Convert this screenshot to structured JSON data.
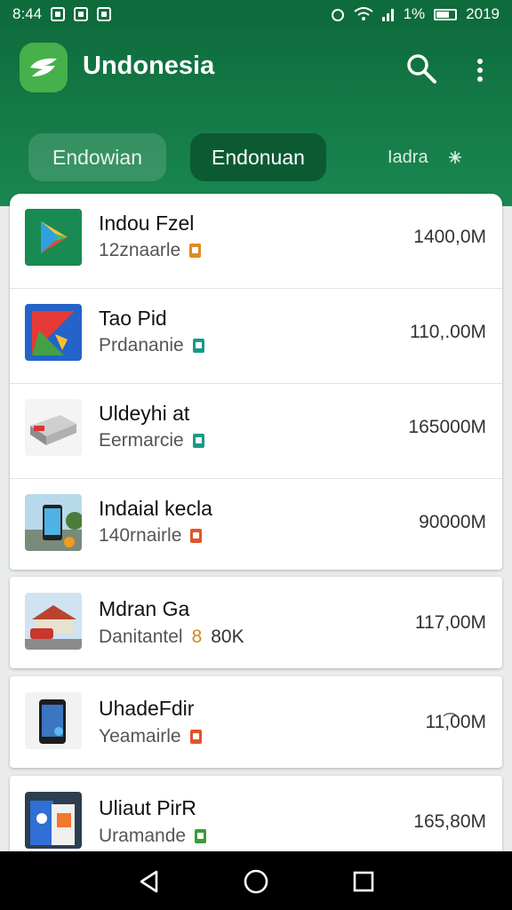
{
  "status": {
    "time": "8:44",
    "battery_text": "1%",
    "year": "2019"
  },
  "header": {
    "title": "Undonesia"
  },
  "tabs": [
    {
      "label": "Endowian"
    },
    {
      "label": "Endonuan"
    },
    {
      "label": "Iadra",
      "icon": "sparkle-icon"
    }
  ],
  "apps": [
    {
      "title": "Indou Fzel",
      "subtitle": "12znaarle",
      "size": "1400,0M",
      "badge_color": "#e08a22",
      "thumb": "play-store"
    },
    {
      "title": "Tao Pid",
      "subtitle": "Prdananie",
      "size": "110,.00M",
      "badge_color": "#189a86",
      "thumb": "colored-shapes"
    },
    {
      "title": "Uldeyhi at",
      "subtitle": "Eermarcie",
      "size": "165000M",
      "badge_color": "#189a86",
      "thumb": "device-box"
    },
    {
      "title": "Indaial kecla",
      "subtitle": "140rnairle",
      "size": "90000M",
      "badge_color": "#e0552a",
      "thumb": "phone-scene"
    },
    {
      "title": "Mdran Ga",
      "subtitle": "Danitantel",
      "subtitle_extra": "8",
      "subtitle_extra2": "80K",
      "size": "117,00M",
      "badge_color": "",
      "thumb": "house-scene"
    },
    {
      "title": "UhadeFdir",
      "subtitle": "Yeamairle",
      "size": "11͡,00M",
      "badge_color": "#e0552a",
      "thumb": "phone-dark"
    },
    {
      "title": "Uliaut PirR",
      "subtitle": "Uramande",
      "size": "165,80M",
      "badge_color": "#3d9a3a",
      "thumb": "brochure"
    }
  ],
  "colors": {
    "header_green": "#0f6d3e",
    "accent_green": "#46b04a"
  }
}
